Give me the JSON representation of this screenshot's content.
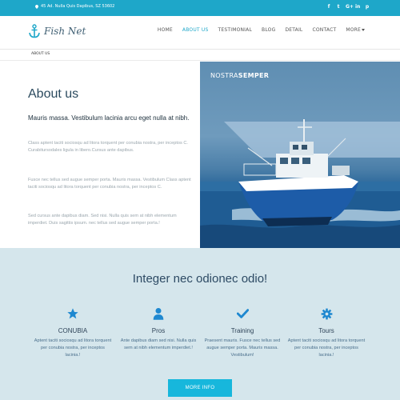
{
  "topbar": {
    "address": "45 Ad. Nulla Quis Dapibus, SZ 53602",
    "socials": [
      {
        "icon": "facebook-icon",
        "glyph": "f"
      },
      {
        "icon": "twitter-icon",
        "glyph": "t"
      },
      {
        "icon": "google-plus-icon",
        "glyph": "G+"
      },
      {
        "icon": "linkedin-icon",
        "glyph": "in"
      },
      {
        "icon": "pinterest-icon",
        "glyph": "p"
      }
    ]
  },
  "header": {
    "brand": "Fish Net",
    "nav": [
      {
        "label": "HOME",
        "active": false
      },
      {
        "label": "ABOUT US",
        "active": true
      },
      {
        "label": "TESTIMONIAL",
        "active": false
      },
      {
        "label": "BLOG",
        "active": false
      },
      {
        "label": "DETAIL",
        "active": false
      },
      {
        "label": "CONTACT",
        "active": false
      },
      {
        "label": "MORE",
        "active": false,
        "dropdown": true
      }
    ]
  },
  "breadcrumb": {
    "current": "ABOUT US"
  },
  "about": {
    "title": "About us",
    "lead": "Mauris massa. Vestibulum lacinia arcu eget nulla at nibh.",
    "paragraphs": [
      "Class aptent taciti sociosqu ad litora torquent per conubia nostra, per inceptos C. Curabitursodales ligula in libero.Cursus ante dapibus.",
      "Fusce nec tellus sed augue semper porta. Mauris massa. Vestibulum Class aptent taciti sociosqu ad litora torquent per conubia nostra, per inceptos C.",
      "Sed cursus ante dapibus diam. Sed nisi. Nulla quis sem at nibh elementum imperdiet. Duis sagittis ipsum. nec tellus sed augue semper porta.!"
    ]
  },
  "hero": {
    "title_light": "NOSTRA",
    "title_bold": "SEMPER"
  },
  "features": {
    "heading": "Integer nec odionec odio!",
    "items": [
      {
        "icon": "star-icon",
        "name": "CONUBIA",
        "desc": "Aptent taciti sociosqu ad litora torquent per conubia nostra, per inceptos lacinia.!"
      },
      {
        "icon": "user-icon",
        "name": "Pros",
        "desc": "Ante dapibus diam sed nisi. Nulla quis sem at nibh elementum imperdiet.!"
      },
      {
        "icon": "check-icon",
        "name": "Training",
        "desc": "Praesent mauris. Fusce nec tellus sed augue semper porta. Mauris massa. Vestibulum!"
      },
      {
        "icon": "gear-icon",
        "name": "Tours",
        "desc": "Aptent taciti sociosqu ad litora torquent per conubia nostra, per inceptos lacinia.!"
      }
    ],
    "button": "MORE INFO"
  },
  "colors": {
    "accent": "#1ea7c9",
    "button": "#17b7dc",
    "section_bg": "#d5e6ec",
    "icon": "#1e88d0"
  }
}
